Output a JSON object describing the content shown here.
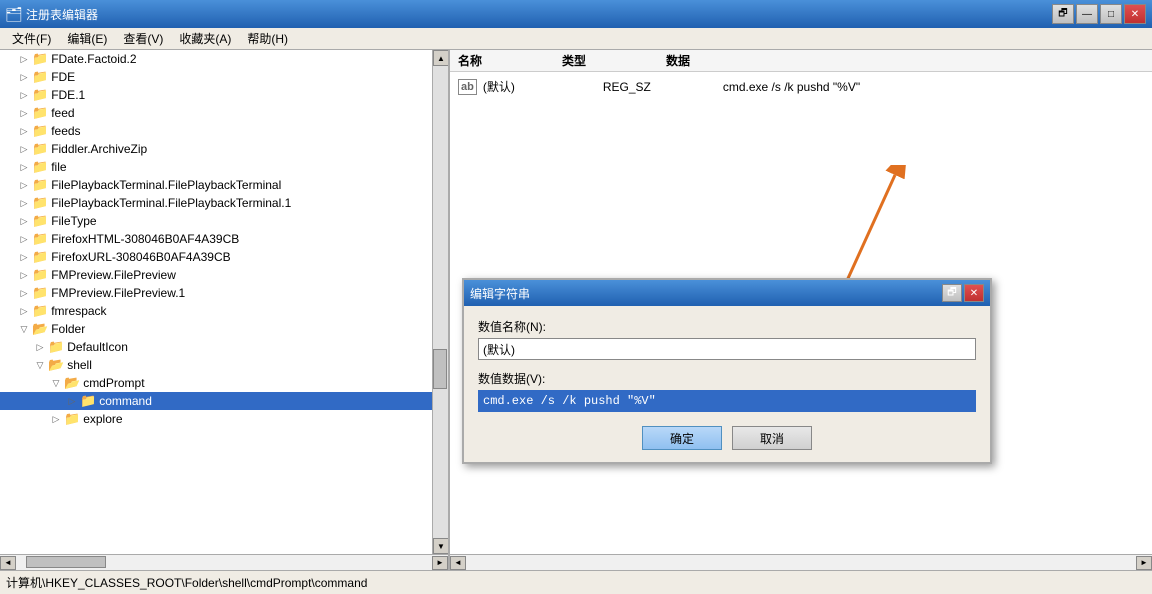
{
  "window": {
    "title": "注册表编辑器",
    "icon": "🗂"
  },
  "titleButtons": {
    "restore": "🗗",
    "minimize": "—",
    "maximize": "□",
    "close": "✕"
  },
  "menu": {
    "items": [
      "文件(F)",
      "编辑(E)",
      "查看(V)",
      "收藏夹(A)",
      "帮助(H)"
    ]
  },
  "tree": {
    "items": [
      {
        "label": "FDate.Factoid.2",
        "level": 1,
        "expanded": false,
        "icon": "📁"
      },
      {
        "label": "FDE",
        "level": 1,
        "expanded": false,
        "icon": "📁"
      },
      {
        "label": "FDE.1",
        "level": 1,
        "expanded": false,
        "icon": "📁"
      },
      {
        "label": "feed",
        "level": 1,
        "expanded": false,
        "icon": "📁"
      },
      {
        "label": "feeds",
        "level": 1,
        "expanded": false,
        "icon": "📁"
      },
      {
        "label": "Fiddler.ArchiveZip",
        "level": 1,
        "expanded": false,
        "icon": "📁"
      },
      {
        "label": "file",
        "level": 1,
        "expanded": false,
        "icon": "📁"
      },
      {
        "label": "FilePlaybackTerminal.FilePlaybackTerminal",
        "level": 1,
        "expanded": false,
        "icon": "📁"
      },
      {
        "label": "FilePlaybackTerminal.FilePlaybackTerminal.1",
        "level": 1,
        "expanded": false,
        "icon": "📁"
      },
      {
        "label": "FileType",
        "level": 1,
        "expanded": false,
        "icon": "📁"
      },
      {
        "label": "FirefoxHTML-308046B0AF4A39CB",
        "level": 1,
        "expanded": false,
        "icon": "📁"
      },
      {
        "label": "FirefoxURL-308046B0AF4A39CB",
        "level": 1,
        "expanded": false,
        "icon": "📁"
      },
      {
        "label": "FMPreview.FilePreview",
        "level": 1,
        "expanded": false,
        "icon": "📁"
      },
      {
        "label": "FMPreview.FilePreview.1",
        "level": 1,
        "expanded": false,
        "icon": "📁"
      },
      {
        "label": "fmrespack",
        "level": 1,
        "expanded": false,
        "icon": "📁"
      },
      {
        "label": "Folder",
        "level": 1,
        "expanded": true,
        "icon": "📂"
      },
      {
        "label": "DefaultIcon",
        "level": 2,
        "expanded": false,
        "icon": "📁"
      },
      {
        "label": "shell",
        "level": 2,
        "expanded": true,
        "icon": "📂"
      },
      {
        "label": "cmdPrompt",
        "level": 3,
        "expanded": true,
        "icon": "📂"
      },
      {
        "label": "command",
        "level": 4,
        "expanded": false,
        "icon": "📁",
        "selected": true
      },
      {
        "label": "explore",
        "level": 3,
        "expanded": false,
        "icon": "📁"
      }
    ]
  },
  "rightPane": {
    "headers": [
      "名称",
      "类型",
      "数据"
    ],
    "entries": [
      {
        "icon": "ab",
        "name": "(默认)",
        "type": "REG_SZ",
        "data": "cmd.exe /s /k pushd \"%V\""
      }
    ]
  },
  "dialog": {
    "title": "编辑字符串",
    "nameLabel": "数值名称(N):",
    "nameValue": "(默认)",
    "dataLabel": "数值数据(V):",
    "dataValue": "cmd.exe /s /k pushd \"%V\"",
    "confirmBtn": "确定",
    "cancelBtn": "取消"
  },
  "statusBar": {
    "text": "计算机\\HKEY_CLASSES_ROOT\\Folder\\shell\\cmdPrompt\\command"
  },
  "colors": {
    "accent": "#316ac5",
    "orange": "#e07020"
  }
}
